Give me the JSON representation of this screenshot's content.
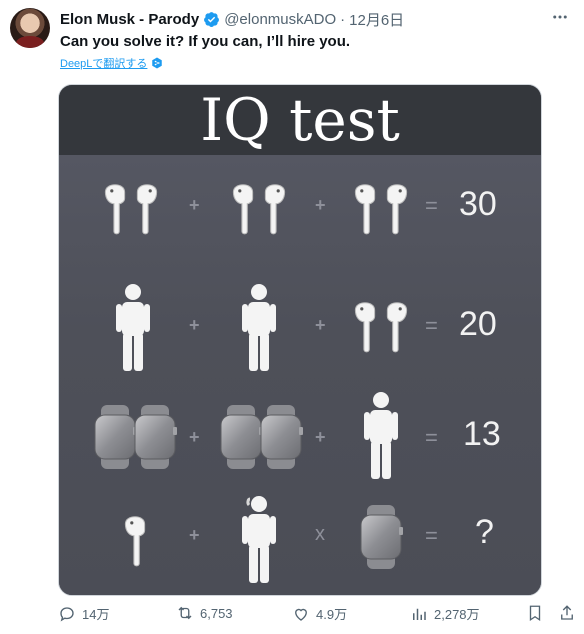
{
  "tweet": {
    "author_name": "Elon Musk - Parody",
    "handle": "@elonmuskADO",
    "separator": "·",
    "date": "12月6日",
    "text": "Can you solve it? If you can, I’ll hire you.",
    "translate_label": "DeepLで翻訳する"
  },
  "media": {
    "title": "IQ test",
    "rows": [
      {
        "items": [
          "airpods-icon",
          "airpods-icon",
          "airpods-icon"
        ],
        "ops": [
          "+",
          "+"
        ],
        "result": "30"
      },
      {
        "items": [
          "person-icon",
          "person-icon",
          "airpods-icon"
        ],
        "ops": [
          "+",
          "+"
        ],
        "result": "20"
      },
      {
        "items": [
          "watches-pair-icon",
          "watches-pair-icon",
          "person-icon"
        ],
        "ops": [
          "+",
          "+"
        ],
        "result": "13"
      },
      {
        "items": [
          "single-airpod-icon",
          "person-with-airpod-icon",
          "watch-icon"
        ],
        "ops": [
          "+",
          "x"
        ],
        "result": "?"
      }
    ],
    "equals": "="
  },
  "actions": {
    "replies": "14万",
    "reposts": "6,753",
    "likes": "4.9万",
    "views": "2,278万"
  },
  "colors": {
    "link": "#1d9bf0",
    "secondary": "#536471",
    "verified": "#1d9bf0"
  }
}
